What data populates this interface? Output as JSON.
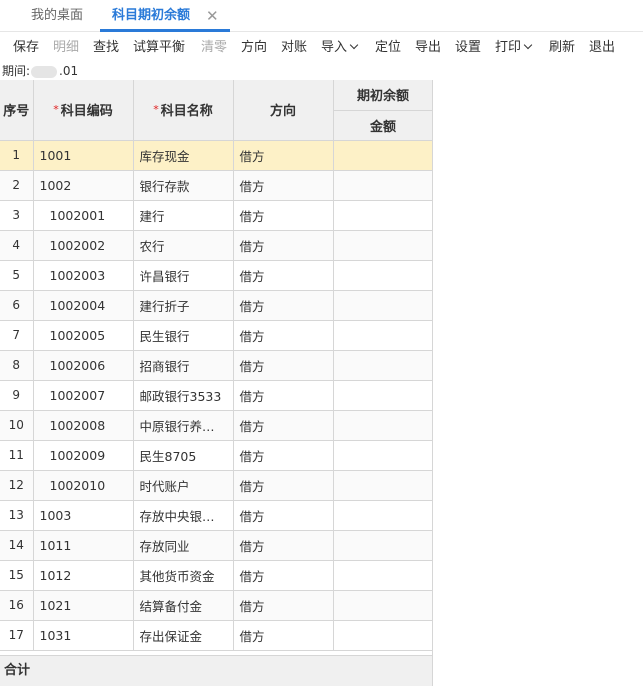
{
  "tabs": {
    "home": "我的桌面",
    "active": "科目期初余额",
    "close": "✕"
  },
  "toolbar": {
    "save": "保存",
    "detail": "明细",
    "find": "查找",
    "trial": "试算平衡",
    "clear": "清零",
    "direction": "方向",
    "reconcile": "对账",
    "import": "导入",
    "locate": "定位",
    "export": "导出",
    "settings": "设置",
    "print": "打印",
    "refresh": "刷新",
    "exit": "退出"
  },
  "period": {
    "label": "期间:",
    "suffix": ".01"
  },
  "table": {
    "headers": {
      "idx": "序号",
      "code": "科目编码",
      "name": "科目名称",
      "dir": "方向",
      "opening": "期初余额",
      "amount": "金额",
      "required_mark": "*"
    },
    "rows": [
      {
        "idx": "1",
        "code": "1001",
        "name": "库存现金",
        "dir": "借方",
        "amount": "",
        "sub": false,
        "selected": true
      },
      {
        "idx": "2",
        "code": "1002",
        "name": "银行存款",
        "dir": "借方",
        "amount": "",
        "sub": false
      },
      {
        "idx": "3",
        "code": "1002001",
        "name": "建行",
        "dir": "借方",
        "amount": "",
        "sub": true
      },
      {
        "idx": "4",
        "code": "1002002",
        "name": "农行",
        "dir": "借方",
        "amount": "",
        "sub": true
      },
      {
        "idx": "5",
        "code": "1002003",
        "name": "许昌银行",
        "dir": "借方",
        "amount": "",
        "sub": true
      },
      {
        "idx": "6",
        "code": "1002004",
        "name": "建行折子",
        "dir": "借方",
        "amount": "",
        "sub": true
      },
      {
        "idx": "7",
        "code": "1002005",
        "name": "民生银行",
        "dir": "借方",
        "amount": "",
        "sub": true
      },
      {
        "idx": "8",
        "code": "1002006",
        "name": "招商银行",
        "dir": "借方",
        "amount": "",
        "sub": true
      },
      {
        "idx": "9",
        "code": "1002007",
        "name": "邮政银行3533",
        "dir": "借方",
        "amount": "",
        "sub": true
      },
      {
        "idx": "10",
        "code": "1002008",
        "name": "中原银行养…",
        "dir": "借方",
        "amount": "",
        "sub": true
      },
      {
        "idx": "11",
        "code": "1002009",
        "name": "民生8705",
        "dir": "借方",
        "amount": "",
        "sub": true
      },
      {
        "idx": "12",
        "code": "1002010",
        "name": "时代账户",
        "dir": "借方",
        "amount": "",
        "sub": true
      },
      {
        "idx": "13",
        "code": "1003",
        "name": "存放中央银…",
        "dir": "借方",
        "amount": "",
        "sub": false
      },
      {
        "idx": "14",
        "code": "1011",
        "name": "存放同业",
        "dir": "借方",
        "amount": "",
        "sub": false
      },
      {
        "idx": "15",
        "code": "1012",
        "name": "其他货币资金",
        "dir": "借方",
        "amount": "",
        "sub": false
      },
      {
        "idx": "16",
        "code": "1021",
        "name": "结算备付金",
        "dir": "借方",
        "amount": "",
        "sub": false
      },
      {
        "idx": "17",
        "code": "1031",
        "name": "存出保证金",
        "dir": "借方",
        "amount": "",
        "sub": false
      }
    ]
  },
  "footer": {
    "total": "合计"
  }
}
